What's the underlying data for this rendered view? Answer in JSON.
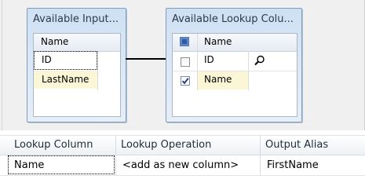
{
  "inputs_box": {
    "title": "Available Input...",
    "header": "Name",
    "rows": [
      "ID",
      "LastName"
    ]
  },
  "lookup_box": {
    "title": "Available Lookup Colu...",
    "header": "Name",
    "rows": [
      {
        "name": "ID",
        "checked": false
      },
      {
        "name": "Name",
        "checked": true
      }
    ]
  },
  "mapping_grid": {
    "columns": [
      "Lookup Column",
      "Lookup Operation",
      "Output Alias"
    ],
    "rows": [
      [
        "Name",
        "<add as new column>",
        "FirstName"
      ]
    ]
  },
  "colors": {
    "accent": "#5b86c7",
    "selected_row": "#fbf7d6",
    "box_border": "#7f9db9"
  },
  "icons": {
    "lookup_search": "magnifier-icon",
    "checkmark": "checkmark-icon"
  }
}
